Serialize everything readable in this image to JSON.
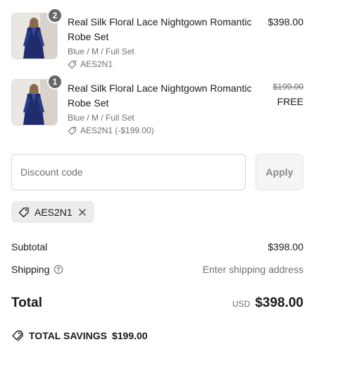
{
  "items": [
    {
      "quantity": "2",
      "title": "Real Silk Floral Lace Nightgown Romantic Robe Set",
      "variant": "Blue / M / Full Set",
      "discount_code": "AES2N1",
      "price": "$398.00",
      "image_icon": "product-thumbnail"
    },
    {
      "quantity": "1",
      "title": "Real Silk Floral Lace Nightgown Romantic Robe Set",
      "variant": "Blue / M / Full Set",
      "discount_code": "AES2N1 (-$199.00)",
      "original_price": "$199.00",
      "price": "FREE",
      "image_icon": "product-thumbnail"
    }
  ],
  "discount": {
    "placeholder": "Discount code",
    "value": "",
    "apply_label": "Apply",
    "applied_code": "AES2N1"
  },
  "summary": {
    "subtotal_label": "Subtotal",
    "subtotal_value": "$398.00",
    "shipping_label": "Shipping",
    "shipping_value": "Enter shipping address",
    "total_label": "Total",
    "currency": "USD",
    "total_value": "$398.00",
    "savings_label": "TOTAL SAVINGS",
    "savings_value": "$199.00"
  },
  "colors": {
    "text": "#1a1a1a",
    "muted": "#707070",
    "badge": "#666666",
    "chip_bg": "#ececec",
    "product_blue": "#1f2d6e"
  }
}
